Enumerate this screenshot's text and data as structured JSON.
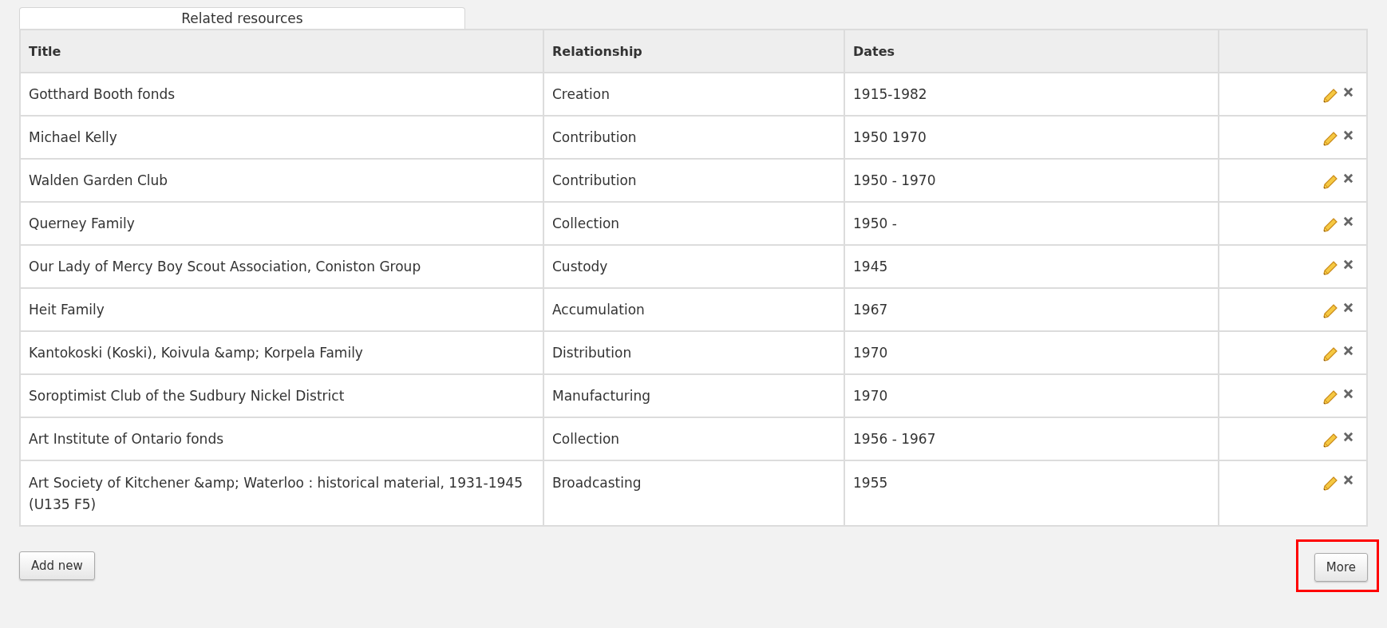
{
  "tab": {
    "label": "Related resources",
    "selected": true
  },
  "table": {
    "columns": [
      "Title",
      "Relationship",
      "Dates"
    ],
    "rows": [
      {
        "title": "Gotthard Booth fonds",
        "relationship": "Creation",
        "dates": "1915-1982"
      },
      {
        "title": "Michael Kelly",
        "relationship": "Contribution",
        "dates": "1950 1970"
      },
      {
        "title": "Walden Garden Club",
        "relationship": "Contribution",
        "dates": "1950 - 1970"
      },
      {
        "title": "Querney Family",
        "relationship": "Collection",
        "dates": "1950 -"
      },
      {
        "title": "Our Lady of Mercy Boy Scout Association, Coniston Group",
        "relationship": "Custody",
        "dates": "1945"
      },
      {
        "title": "Heit Family",
        "relationship": "Accumulation",
        "dates": "1967"
      },
      {
        "title": "Kantokoski (Koski), Koivula &amp; Korpela Family",
        "relationship": "Distribution",
        "dates": "1970"
      },
      {
        "title": "Soroptimist Club of the Sudbury Nickel District",
        "relationship": "Manufacturing",
        "dates": "1970"
      },
      {
        "title": "Art Institute of Ontario fonds",
        "relationship": "Collection",
        "dates": "1956 - 1967"
      },
      {
        "title": "Art Society of Kitchener &amp; Waterloo : historical material, 1931-1945 (U135 F5)",
        "relationship": "Broadcasting",
        "dates": "1955"
      }
    ]
  },
  "buttons": [
    {
      "label": "Add new",
      "highlighted": false
    },
    {
      "label": "More",
      "highlighted": true
    }
  ]
}
